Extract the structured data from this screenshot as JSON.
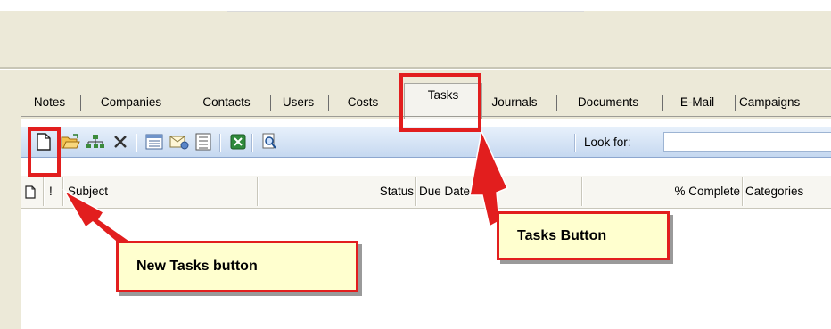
{
  "tabs": [
    {
      "label": "Notes"
    },
    {
      "label": "Companies"
    },
    {
      "label": "Contacts"
    },
    {
      "label": "Users"
    },
    {
      "label": "Costs"
    },
    {
      "label": "Tasks",
      "active": true
    },
    {
      "label": "Journals"
    },
    {
      "label": "Documents"
    },
    {
      "label": "E-Mail"
    },
    {
      "label": "Campaigns"
    }
  ],
  "toolbar": {
    "buttons": [
      "new-icon",
      "open-folder-icon",
      "assign-icon",
      "delete-icon",
      "details-icon",
      "mail-icon",
      "list-icon",
      "excel-icon",
      "search-zoom-icon"
    ],
    "look_for_label": "Look for:",
    "look_for_value": ""
  },
  "grid": {
    "columns": [
      "",
      "",
      "Subject",
      "Status",
      "Due Date",
      "% Complete",
      "Categories"
    ],
    "header_icon": "document-icon",
    "header_sort_marker": "!"
  },
  "callouts": {
    "tasks_button": "Tasks Button",
    "new_tasks_button": "New Tasks button"
  },
  "colors": {
    "highlight_red": "#E21E1E",
    "callout_fill": "#FFFFCF",
    "toolbar_blue": "#C5D8F0"
  }
}
